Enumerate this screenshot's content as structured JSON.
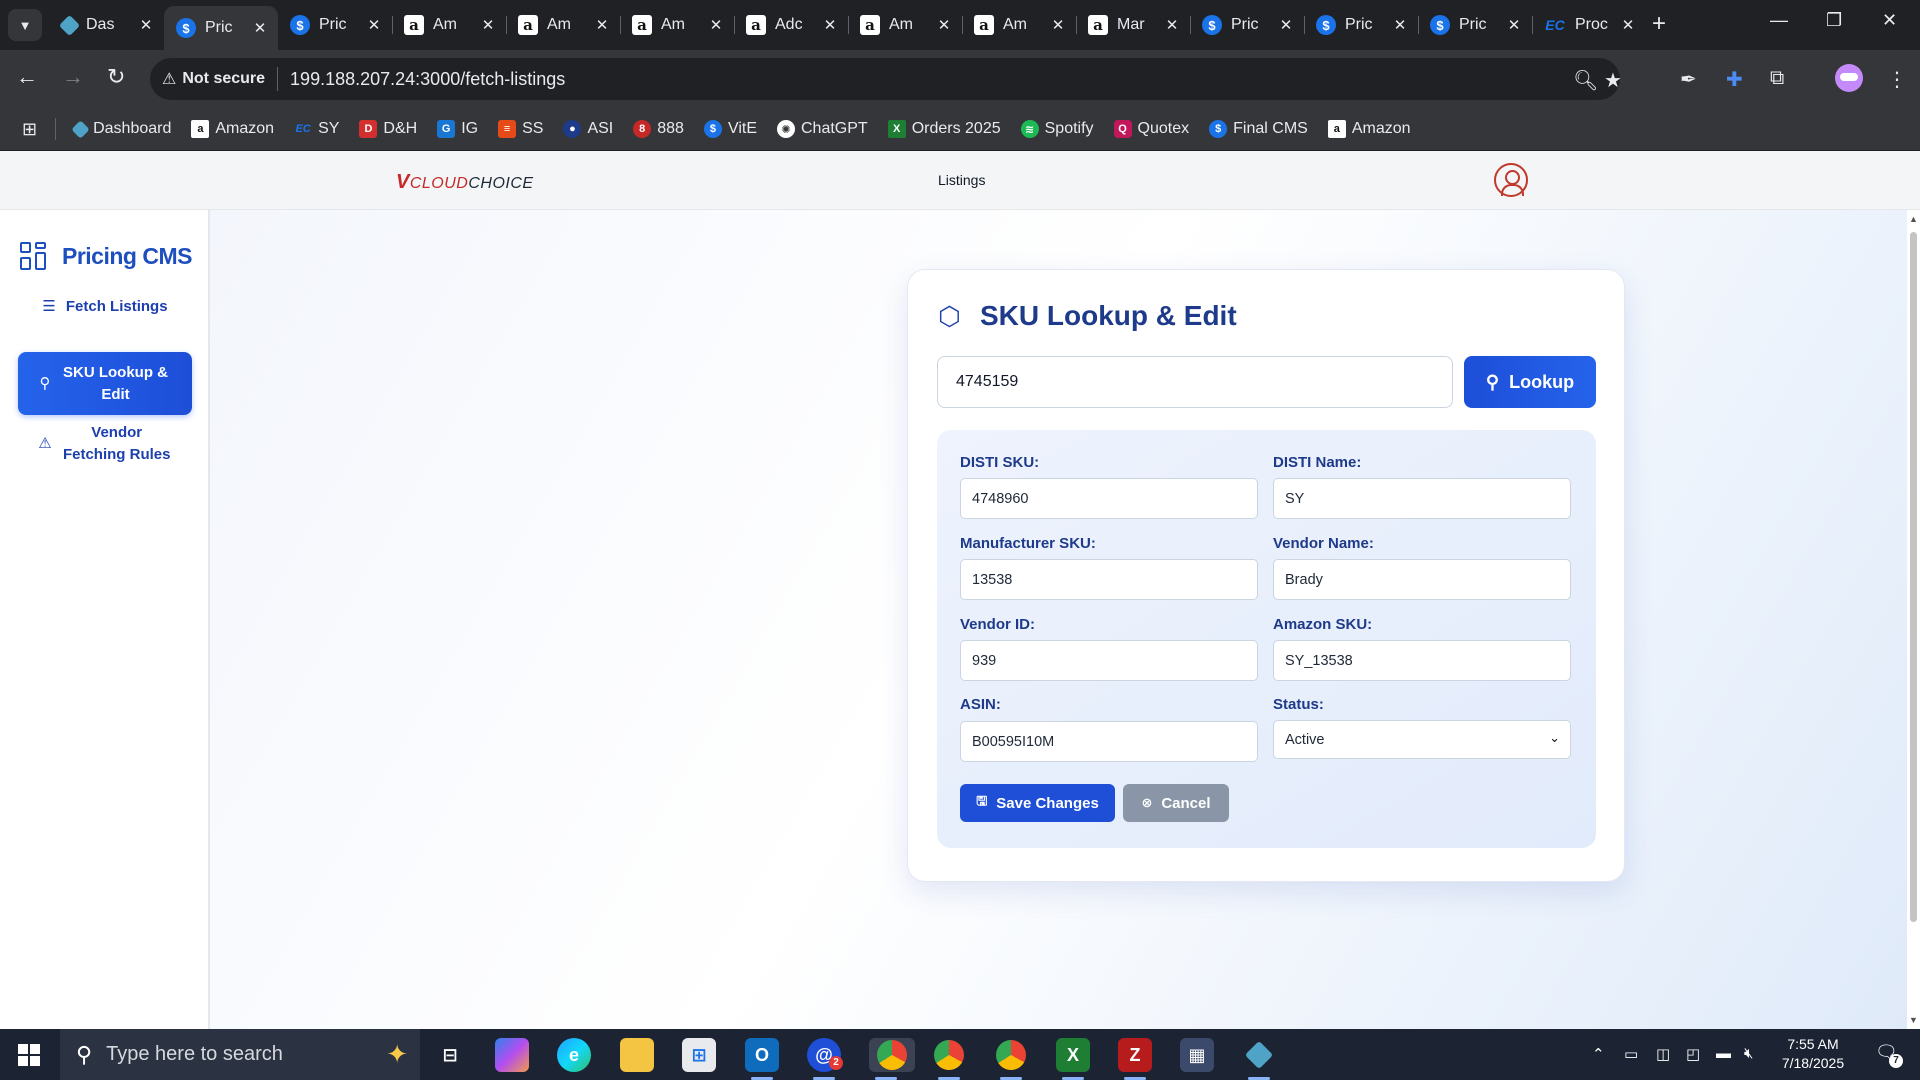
{
  "browser": {
    "tabs": [
      {
        "title": "Das",
        "icon": "dash-icon"
      },
      {
        "title": "Pric",
        "icon": "dollar-icon",
        "active": true
      },
      {
        "title": "Pric",
        "icon": "dollar-icon"
      },
      {
        "title": "Am",
        "icon": "amazon-icon"
      },
      {
        "title": "Am",
        "icon": "amazon-icon"
      },
      {
        "title": "Am",
        "icon": "amazon-icon"
      },
      {
        "title": "Adc",
        "icon": "amazon-icon"
      },
      {
        "title": "Am",
        "icon": "amazon-icon"
      },
      {
        "title": "Am",
        "icon": "amazon-icon"
      },
      {
        "title": "Mar",
        "icon": "amazon-icon"
      },
      {
        "title": "Pric",
        "icon": "dollar-icon"
      },
      {
        "title": "Pric",
        "icon": "dollar-icon"
      },
      {
        "title": "Pric",
        "icon": "dollar-icon"
      },
      {
        "title": "Proc",
        "icon": "ec-icon"
      }
    ],
    "security_label": "Not secure",
    "url": "199.188.207.24:3000/fetch-listings",
    "bookmarks": [
      {
        "label": "Dashboard",
        "color": "#4fa3c7"
      },
      {
        "label": "Amazon",
        "color": "#111111"
      },
      {
        "label": "SY",
        "color": "#1a73e8"
      },
      {
        "label": "D&H",
        "color": "#d32f2f"
      },
      {
        "label": "IG",
        "color": "#1976d2"
      },
      {
        "label": "SS",
        "color": "#e64a19"
      },
      {
        "label": "ASI",
        "color": "#1e3a8a"
      },
      {
        "label": "888",
        "color": "#c62828"
      },
      {
        "label": "VitE",
        "color": "#1a73e8"
      },
      {
        "label": "ChatGPT",
        "color": "#444444"
      },
      {
        "label": "Orders 2025",
        "color": "#1e7e34"
      },
      {
        "label": "Spotify",
        "color": "#1db954"
      },
      {
        "label": "Quotex",
        "color": "#c2185b"
      },
      {
        "label": "Final CMS",
        "color": "#1a73e8"
      },
      {
        "label": "Amazon",
        "color": "#111111"
      }
    ]
  },
  "header": {
    "brand_v": "V",
    "brand_cloud": "CLOUD",
    "brand_choice": "CHOICE",
    "nav_label": "Listings"
  },
  "sidebar": {
    "title": "Pricing CMS",
    "items": [
      {
        "label": "Fetch Listings"
      },
      {
        "label": "SKU Lookup & Edit",
        "active": true
      },
      {
        "label": "Vendor Fetching Rules"
      }
    ]
  },
  "card": {
    "title": "SKU Lookup & Edit",
    "search_value": "4745159",
    "lookup_label": "Lookup",
    "fields": {
      "disti_sku": {
        "label": "DISTI SKU:",
        "value": "4748960"
      },
      "disti_name": {
        "label": "DISTI Name:",
        "value": "SY"
      },
      "manufacturer_sku": {
        "label": "Manufacturer SKU:",
        "value": "13538"
      },
      "vendor_name": {
        "label": "Vendor Name:",
        "value": "Brady"
      },
      "vendor_id": {
        "label": "Vendor ID:",
        "value": "939"
      },
      "amazon_sku": {
        "label": "Amazon SKU:",
        "value": "SY_13538"
      },
      "asin": {
        "label": "ASIN:",
        "value": "B00595I10M"
      },
      "status": {
        "label": "Status:",
        "value": "Active"
      }
    },
    "save_label": "Save Changes",
    "cancel_label": "Cancel"
  },
  "taskbar": {
    "search_placeholder": "Type here to search",
    "time": "7:55 AM",
    "date": "7/18/2025",
    "notification_count": "7",
    "mail_badge": "2"
  }
}
